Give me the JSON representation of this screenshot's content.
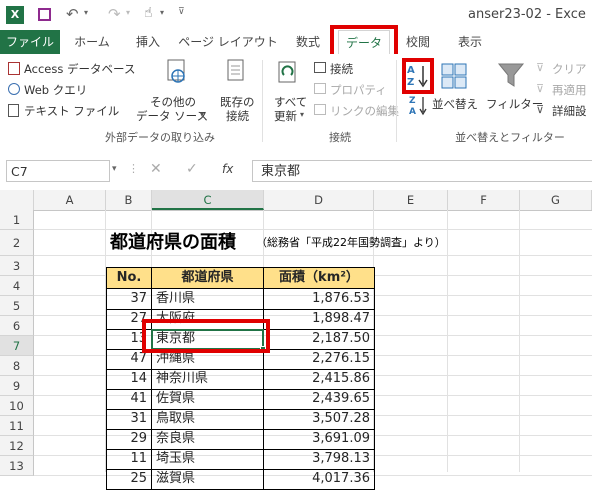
{
  "window": {
    "title": "anser23-02 - Exce"
  },
  "tabs": [
    "ファイル",
    "ホーム",
    "挿入",
    "ページ レイアウト",
    "数式",
    "データ",
    "校閲",
    "表示"
  ],
  "ribbon": {
    "external": {
      "access": "Access データベース",
      "web": "Web クエリ",
      "text": "テキスト ファイル",
      "other_line1": "その他の",
      "other_line2": "データ ソース",
      "existing_line1": "既存の",
      "existing_line2": "接続",
      "label": "外部データの取り込み"
    },
    "connections": {
      "refresh_line1": "すべて",
      "refresh_line2": "更新",
      "connect": "接続",
      "properties": "プロパティ",
      "edit_links": "リンクの編集",
      "label": "接続"
    },
    "sort": {
      "sort": "並べ替え",
      "filter": "フィルター",
      "clear": "クリア",
      "reapply": "再適用",
      "advanced": "詳細設",
      "label": "並べ替えとフィルター"
    }
  },
  "formula": {
    "namebox": "C7",
    "fx": "fx",
    "value": "東京都"
  },
  "columns": [
    "A",
    "B",
    "C",
    "D",
    "E",
    "F",
    "G"
  ],
  "rows": [
    "1",
    "2",
    "3",
    "4",
    "5",
    "6",
    "7",
    "8",
    "9",
    "10",
    "11",
    "12",
    "13",
    "14"
  ],
  "sheet": {
    "title": "都道府県の面積",
    "subtitle": "（総務省「平成22年国勢調査」より）",
    "headers": {
      "no": "No.",
      "pref": "都道府県",
      "area": "面積（km²）"
    },
    "data": [
      {
        "no": "37",
        "pref": "香川県",
        "area": "1,876.53"
      },
      {
        "no": "27",
        "pref": "大阪府",
        "area": "1,898.47"
      },
      {
        "no": "13",
        "pref": "東京都",
        "area": "2,187.50"
      },
      {
        "no": "47",
        "pref": "沖縄県",
        "area": "2,276.15"
      },
      {
        "no": "14",
        "pref": "神奈川県",
        "area": "2,415.86"
      },
      {
        "no": "41",
        "pref": "佐賀県",
        "area": "2,439.65"
      },
      {
        "no": "31",
        "pref": "鳥取県",
        "area": "3,507.28"
      },
      {
        "no": "29",
        "pref": "奈良県",
        "area": "3,691.09"
      },
      {
        "no": "11",
        "pref": "埼玉県",
        "area": "3,798.13"
      },
      {
        "no": "25",
        "pref": "滋賀県",
        "area": "4,017.36"
      }
    ]
  },
  "colors": {
    "file_tab": "#217346",
    "highlight": "#e00000",
    "header_fill": "#ffe08a"
  }
}
